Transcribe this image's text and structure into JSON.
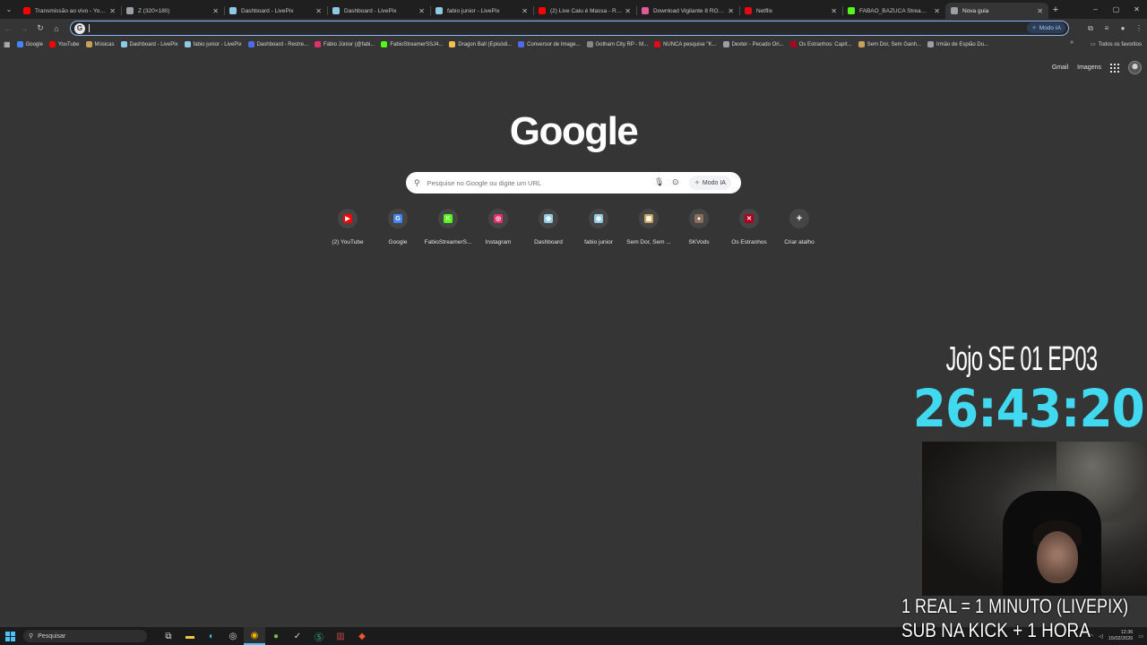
{
  "tabs": [
    {
      "title": "Transmissão ao vivo - YouTube",
      "color": "#ff0000"
    },
    {
      "title": "Z (320×180)",
      "color": "#9aa0a6"
    },
    {
      "title": "Dashboard - LivePix",
      "color": "#8ecae6"
    },
    {
      "title": "Dashboard - LivePix",
      "color": "#8ecae6"
    },
    {
      "title": "fabio junior - LivePix",
      "color": "#8ecae6"
    },
    {
      "title": "(2) Live Caiu é Massa - Rica G...",
      "color": "#ff0000"
    },
    {
      "title": "Download Vigilante 8 ROM &...",
      "color": "#e05a9a"
    },
    {
      "title": "Netflix",
      "color": "#e50914"
    },
    {
      "title": "FABAO_BAZUCA Stream - Wa...",
      "color": "#53fc18"
    },
    {
      "title": "Nova guia",
      "color": "#9aa0a6",
      "active": true
    }
  ],
  "window_controls": {
    "minimize": "–",
    "maximize": "▢",
    "close": "✕"
  },
  "toolbar": {
    "back": "←",
    "forward": "→",
    "reload": "↻",
    "home": "⌂",
    "omnibox_value": "",
    "modo_ia_label": "Modo IA"
  },
  "bookmarks": [
    {
      "label": "Google",
      "color": "#4285f4"
    },
    {
      "label": "YouTube",
      "color": "#ff0000"
    },
    {
      "label": "Músicas",
      "color": "#c8a25a"
    },
    {
      "label": "Dashboard - LivePix",
      "color": "#8ecae6"
    },
    {
      "label": "fabio junior - LivePix",
      "color": "#8ecae6"
    },
    {
      "label": "Dashboard - Restre...",
      "color": "#4f6bed"
    },
    {
      "label": "Fábio Júnior (@fabi...",
      "color": "#e1306c"
    },
    {
      "label": "FabioStreamerSSJ4...",
      "color": "#53fc18"
    },
    {
      "label": "Dragon Ball (Episódi...",
      "color": "#f2c14e"
    },
    {
      "label": "Conversor de Image...",
      "color": "#4f6bed"
    },
    {
      "label": "Gotham City RP - M...",
      "color": "#888888"
    },
    {
      "label": "NUNCA pesquise \"K...",
      "color": "#e50914"
    },
    {
      "label": "Dexter - Pecado Ori...",
      "color": "#9aa0a6"
    },
    {
      "label": "Os Estranhos: Capít...",
      "color": "#b00020"
    },
    {
      "label": "Sem Dor, Sem Ganh...",
      "color": "#c8a25a"
    },
    {
      "label": "Irmão de Espião Du...",
      "color": "#9aa0a6"
    }
  ],
  "bookmarks_all": "Todos os favoritos",
  "top_links": {
    "gmail": "Gmail",
    "images": "Imagens"
  },
  "logo": "Google",
  "search": {
    "placeholder": "Pesquise no Google ou digite um URL",
    "modo_ia": "Modo IA"
  },
  "shortcuts": [
    {
      "label": "(2) YouTube",
      "color": "#ff0000",
      "glyph": "▶"
    },
    {
      "label": "Google",
      "color": "#4285f4",
      "glyph": "G"
    },
    {
      "label": "FabioStreamerS...",
      "color": "#53fc18",
      "glyph": "K"
    },
    {
      "label": "Instagram",
      "color": "#e1306c",
      "glyph": "◎"
    },
    {
      "label": "Dashboard",
      "color": "#8ecae6",
      "glyph": "◉"
    },
    {
      "label": "fabio junior",
      "color": "#8ecae6",
      "glyph": "◉"
    },
    {
      "label": "Sem Dor, Sem ...",
      "color": "#c8a25a",
      "glyph": "▦"
    },
    {
      "label": "SKVods",
      "color": "#8b6d5c",
      "glyph": "●"
    },
    {
      "label": "Os Estranhos",
      "color": "#b00020",
      "glyph": "✕"
    },
    {
      "label": "Criar atalho",
      "color": "#454545",
      "glyph": "+"
    }
  ],
  "overlay": {
    "title": "Jojo SE 01 EP03",
    "timer": "26:43:20",
    "line1": "1 REAL = 1 MINUTO (LIVEPIX)",
    "line2": "SUB NA KICK + 1 HORA"
  },
  "taskbar": {
    "search_label": "Pesquisar",
    "time": "12:36",
    "date": "15/02/2026"
  }
}
